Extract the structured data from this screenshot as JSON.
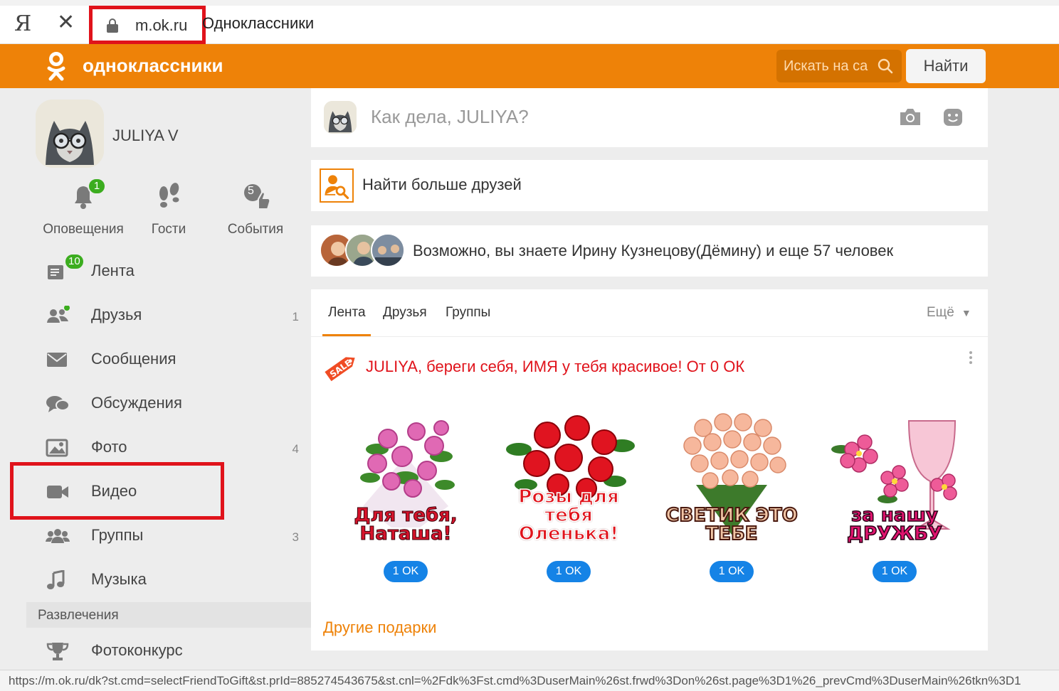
{
  "browser": {
    "logo": "Я",
    "close_glyph": "✕",
    "url": "m.ok.ru",
    "page_title": "Одноклассники"
  },
  "header": {
    "brand": "одноклассники",
    "search_placeholder": "Искать на са",
    "find_button": "Найти",
    "accent_color": "#ee8208"
  },
  "profile": {
    "name": "JULIYA V"
  },
  "quick_links": [
    {
      "label": "Оповещения",
      "icon": "bell-icon",
      "badge": "1"
    },
    {
      "label": "Гости",
      "icon": "footprints-icon"
    },
    {
      "label": "События",
      "icon": "events-icon",
      "count": "5"
    }
  ],
  "menu": [
    {
      "label": "Лента",
      "icon": "feed-icon",
      "badge": "10"
    },
    {
      "label": "Друзья",
      "icon": "friends-icon",
      "count": "1"
    },
    {
      "label": "Сообщения",
      "icon": "envelope-icon"
    },
    {
      "label": "Обсуждения",
      "icon": "chat-bubbles-icon"
    },
    {
      "label": "Фото",
      "icon": "photo-icon",
      "count": "4"
    },
    {
      "label": "Видео",
      "icon": "video-camera-icon"
    },
    {
      "label": "Группы",
      "icon": "groups-icon",
      "count": "3"
    },
    {
      "label": "Музыка",
      "icon": "music-note-icon"
    }
  ],
  "section": {
    "entertainment": "Развлечения",
    "photo_contest": "Фотоконкурс"
  },
  "post": {
    "prompt": "Как дела, JULIYA?"
  },
  "find_friends": {
    "label": "Найти больше друзей"
  },
  "maybe_know": {
    "text": "Возможно, вы знаете Ирину Кузнецову(Дёмину) и еще 57 человек"
  },
  "feed": {
    "tabs": [
      "Лента",
      "Друзья",
      "Группы"
    ],
    "more": "Ещё",
    "promo": "JULIYA, береги себя, ИМЯ у тебя красивое! От 0 ОК",
    "gifts": [
      {
        "caption": "Для тебя, Наташа!",
        "price": "1 OK"
      },
      {
        "caption": "Розы для тебя Оленька!",
        "price": "1 OK"
      },
      {
        "caption": "СВЕТИК ЭТО ТЕБЕ",
        "price": "1 OK"
      },
      {
        "caption": "за нашу ДРУЖБУ",
        "price": "1 OK"
      }
    ],
    "other_gifts": "Другие подарки"
  },
  "statusbar": {
    "url": "https://m.ok.ru/dk?st.cmd=selectFriendToGift&st.prId=885274543675&st.cnl=%2Fdk%3Fst.cmd%3DuserMain%26st.frwd%3Don%26st.page%3D1%26_prevCmd%3DuserMain%26tkn%3D1"
  }
}
